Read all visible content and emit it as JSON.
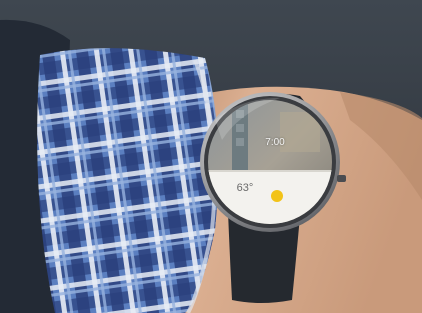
{
  "watch": {
    "time": "7:00",
    "weather_card": {
      "temperature": "63°",
      "icon": "sun-icon",
      "icon_color": "#f2c318"
    }
  },
  "colors": {
    "background": "#30363e",
    "sleeve_blue": "#4a6fb2",
    "skin": "#d9ac8c",
    "watch_band": "#262a30"
  }
}
